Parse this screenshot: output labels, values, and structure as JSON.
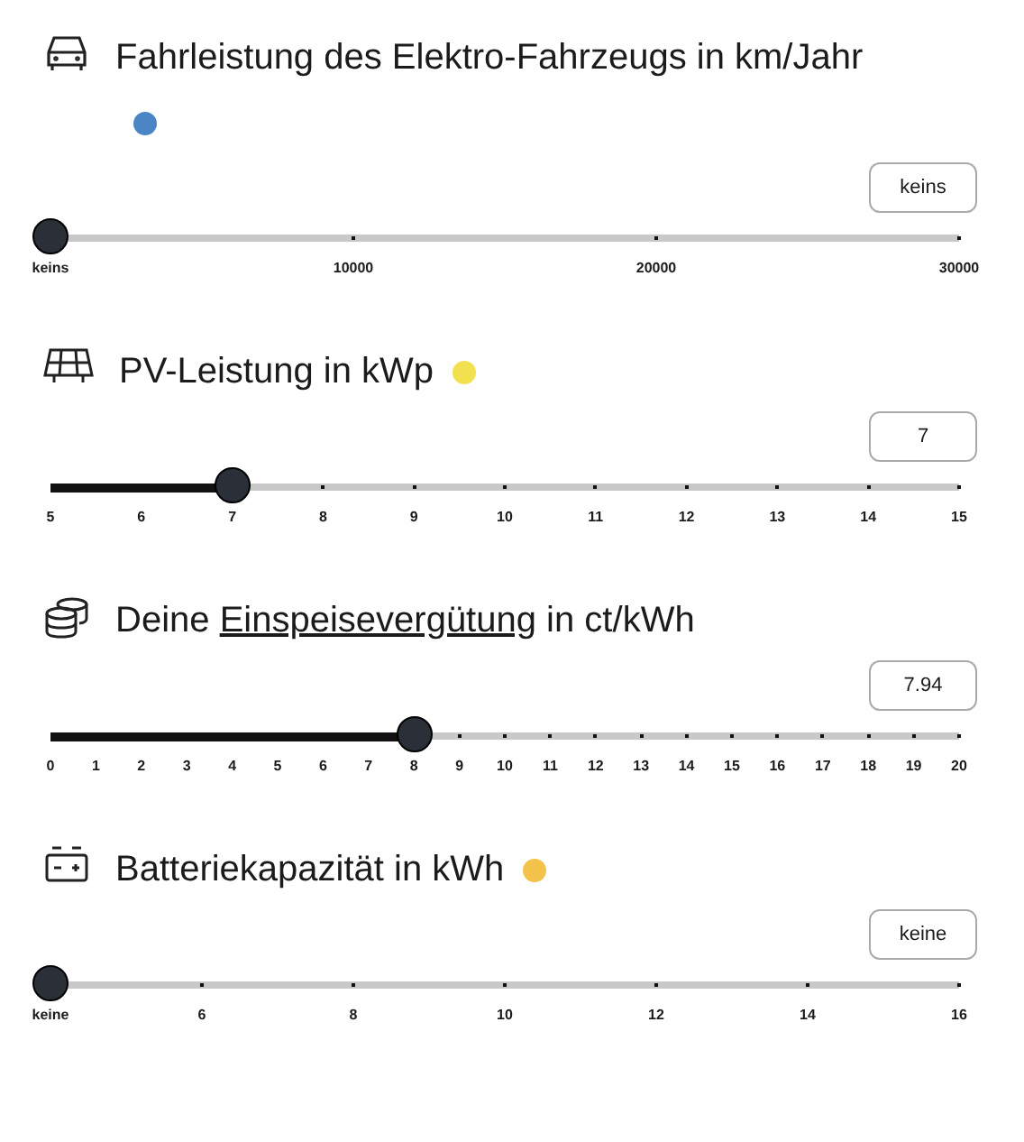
{
  "sliders": [
    {
      "title": [
        {
          "text": "Fahrleistung des Elektro-Fahrzeugs in km/Jahr"
        }
      ],
      "color": "#4a86c5",
      "value": "keins",
      "level": 0,
      "ticks": [
        "keins",
        "10000",
        "20000",
        "30000"
      ]
    },
    {
      "title": [
        {
          "text": "PV-Leistung in kWp"
        }
      ],
      "color": "#f3e04e",
      "value": "7",
      "level": 0.2,
      "ticks": [
        "5",
        "6",
        "7",
        "8",
        "9",
        "10",
        "11",
        "12",
        "13",
        "14",
        "15"
      ]
    },
    {
      "title": [
        {
          "text": "Deine "
        },
        {
          "text": "Einspeisevergütung",
          "kind": "link"
        },
        {
          "text": " in ct/kWh"
        }
      ],
      "value": "7.94",
      "level": 0.4,
      "ticks": [
        "0",
        "1",
        "2",
        "3",
        "4",
        "5",
        "6",
        "7",
        "8",
        "9",
        "10",
        "11",
        "12",
        "13",
        "14",
        "15",
        "16",
        "17",
        "18",
        "19",
        "20"
      ]
    },
    {
      "title": [
        {
          "text": "Batteriekapazität in kWh"
        }
      ],
      "color": "#f3c24a",
      "value": "keine",
      "level": 0,
      "ticks": [
        "keine",
        "6",
        "8",
        "10",
        "12",
        "14",
        "16"
      ]
    }
  ]
}
